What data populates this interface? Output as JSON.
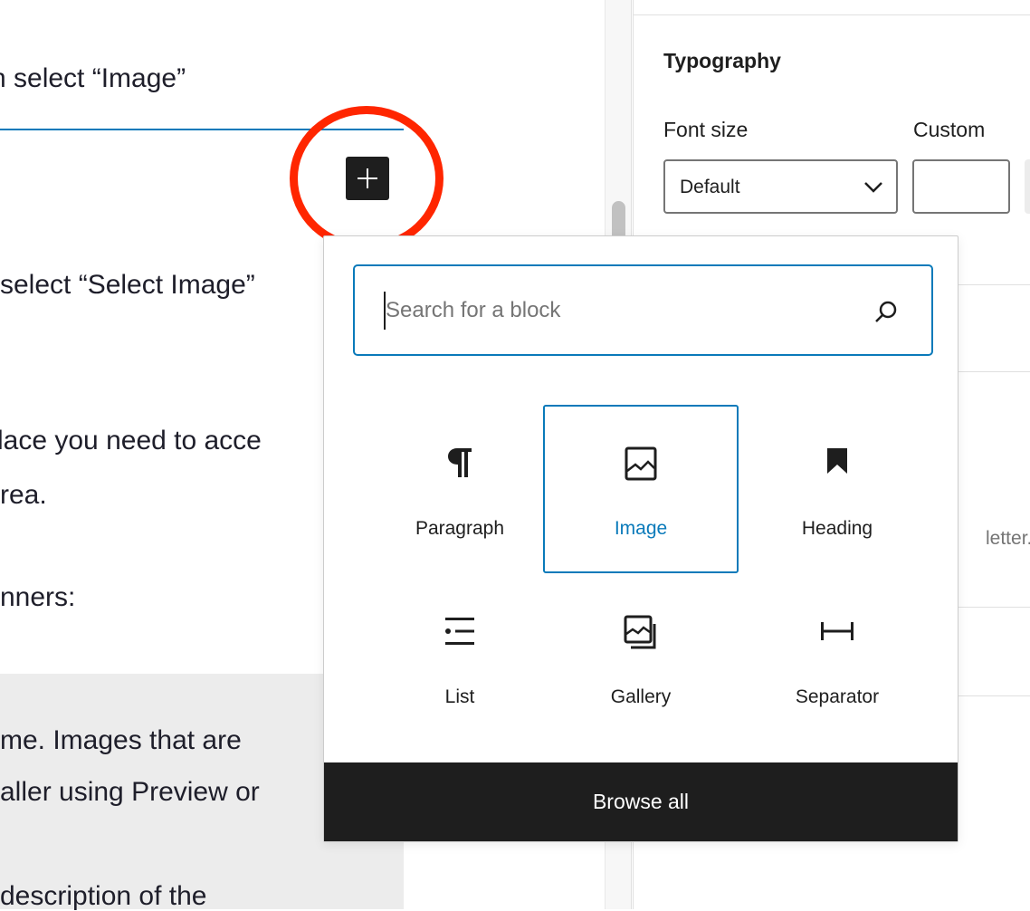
{
  "editor": {
    "lines": [
      "n select “Image”",
      "select “Select Image”",
      "lace you need to acce",
      "rea.",
      "nners:",
      "me. Images that are",
      "aller using Preview or",
      "description of the"
    ],
    "inserter_button_label": "+"
  },
  "sidebar": {
    "section_title": "Typography",
    "font_size_label": "Font size",
    "custom_label": "Custom",
    "font_size_selected": "Default",
    "custom_value": "",
    "partial_help_text": "letter."
  },
  "inserter": {
    "search_placeholder": "Search for a block",
    "search_value": "",
    "blocks": [
      {
        "label": "Paragraph",
        "icon": "paragraph-icon",
        "selected": false
      },
      {
        "label": "Image",
        "icon": "image-icon",
        "selected": true
      },
      {
        "label": "Heading",
        "icon": "heading-bookmark-icon",
        "selected": false
      },
      {
        "label": "List",
        "icon": "list-icon",
        "selected": false
      },
      {
        "label": "Gallery",
        "icon": "gallery-icon",
        "selected": false
      },
      {
        "label": "Separator",
        "icon": "separator-icon",
        "selected": false
      }
    ],
    "browse_all_label": "Browse all"
  },
  "colors": {
    "accent": "#0a7aba",
    "annotation": "#ff2600",
    "dark": "#1e1e1e"
  }
}
